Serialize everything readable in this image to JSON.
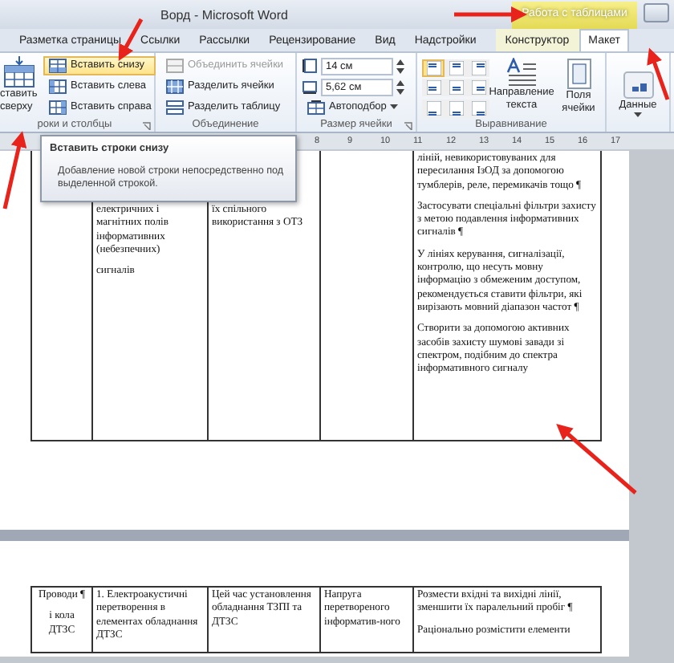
{
  "window": {
    "title": "Ворд - Microsoft Word",
    "contextual_group": "Работа с таблицами"
  },
  "tabs": [
    {
      "label": "Разметка страницы",
      "selected": false
    },
    {
      "label": "Ссылки",
      "selected": false
    },
    {
      "label": "Рассылки",
      "selected": false
    },
    {
      "label": "Рецензирование",
      "selected": false
    },
    {
      "label": "Вид",
      "selected": false
    },
    {
      "label": "Надстройки",
      "selected": false
    },
    {
      "label": "Конструктор",
      "selected": false,
      "contextual": true
    },
    {
      "label": "Макет",
      "selected": true,
      "contextual": true
    }
  ],
  "ribbon": {
    "groups": [
      {
        "label": "роки и столбцы",
        "launcher": true,
        "items": [
          {
            "kind": "big",
            "label": "ставить сверху",
            "disabled": false,
            "highlighted": false
          },
          {
            "kind": "small",
            "label": "Вставить снизу",
            "disabled": false,
            "highlighted": true
          },
          {
            "kind": "small",
            "label": "Вставить слева",
            "disabled": false,
            "highlighted": false
          },
          {
            "kind": "small",
            "label": "Вставить справа",
            "disabled": false,
            "highlighted": false
          }
        ]
      },
      {
        "label": "Объединение",
        "launcher": false,
        "items": [
          {
            "kind": "small",
            "label": "Объединить ячейки",
            "disabled": true,
            "highlighted": false
          },
          {
            "kind": "small",
            "label": "Разделить ячейки",
            "disabled": false,
            "highlighted": false
          },
          {
            "kind": "small",
            "label": "Разделить таблицу",
            "disabled": false,
            "highlighted": false
          }
        ]
      },
      {
        "label": "Размер ячейки",
        "launcher": true,
        "items": [
          {
            "kind": "spin",
            "value": "14 см"
          },
          {
            "kind": "spin",
            "value": "5,62 см"
          },
          {
            "kind": "dropdown",
            "label": "Автоподбор"
          }
        ]
      },
      {
        "label": "Выравнивание",
        "launcher": false,
        "items": [
          {
            "kind": "align-grid",
            "cells": [
              {
                "selected": true
              },
              {
                "selected": false
              },
              {
                "selected": false
              },
              {
                "selected": false
              },
              {
                "selected": false
              },
              {
                "selected": false
              },
              {
                "selected": false
              },
              {
                "selected": false
              },
              {
                "selected": false
              }
            ]
          },
          {
            "kind": "big",
            "label": "Направление текста",
            "disabled": false,
            "highlighted": false
          },
          {
            "kind": "big",
            "label": "Поля ячейки",
            "disabled": false,
            "highlighted": false
          }
        ]
      },
      {
        "items": [
          {
            "kind": "big-dropdown",
            "label": "Данные"
          }
        ]
      }
    ]
  },
  "ruler": [
    "8",
    "9",
    "10",
    "11",
    "12",
    "13",
    "14",
    "15",
    "16",
    "17"
  ],
  "tooltip": {
    "title": "Вставить строки снизу",
    "text": "Добавление новой строки непосредственно под выделенной строкой."
  },
  "pages": [
    {
      "rows": [
        {
          "cells": [
            [],
            [
              "електричних і магнітних полів інформативних (небезпечних)",
              "сигналів"
            ],
            [
              "їх спільного використання з ОТЗ"
            ],
            [],
            [
              "ліній, невикористовуваних для пересилання ІзОД за допомогою тумблерів, реле, перемикачів тощо ¶",
              "Застосувати спеціальні фільтри захисту з метою подавлення інформативних сигналів ¶",
              "У лініях керування, сигналізації, контролю, що несуть мовну інформацію з обмеженим доступом, рекомендується ставити фільтри, які вирізають мовний діапазон частот ¶",
              "Створити за допомогою активних засобів захисту шумові завади зі спектром, подібним до спектра інформативного сигналу"
            ]
          ]
        }
      ]
    },
    {
      "rows": [
        {
          "cells": [
            [
              "Проводи ¶",
              "і кола ДТЗС"
            ],
            [
              "1. Електроакустичні перетворення в елементах обладнання ДТЗС"
            ],
            [
              "Цей час установлення обладнання ТЗПІ та ДТЗС"
            ],
            [
              "Напруга перетвореного інформатив-ного"
            ],
            [
              "Розмести вхідні та вихідні лінії, зменшити їх паралельний пробіг ¶",
              "Раціонально розмістити елементи"
            ]
          ]
        }
      ]
    }
  ]
}
